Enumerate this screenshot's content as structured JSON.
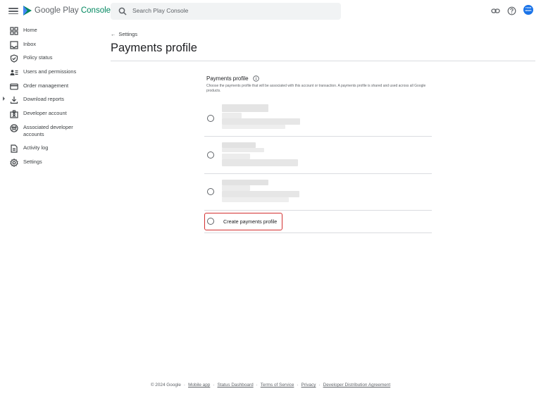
{
  "header": {
    "brand_text": "Google Play",
    "brand_accent": "Console",
    "search_placeholder": "Search Play Console",
    "avatar_text": "YOUR NEWS",
    "accent_color": "#01875f",
    "avatar_color": "#1a73e8"
  },
  "sidebar": {
    "items": [
      {
        "label": "Home",
        "icon": "grid-icon"
      },
      {
        "label": "Inbox",
        "icon": "inbox-icon"
      },
      {
        "label": "Policy status",
        "icon": "shield-icon"
      },
      {
        "label": "Users and permissions",
        "icon": "users-icon"
      },
      {
        "label": "Order management",
        "icon": "credit-card-icon"
      },
      {
        "label": "Download reports",
        "icon": "download-icon",
        "expandable": true
      },
      {
        "label": "Developer account",
        "icon": "badge-icon"
      },
      {
        "label": "Associated developer accounts",
        "icon": "linked-accounts-icon"
      },
      {
        "label": "Activity log",
        "icon": "document-icon"
      },
      {
        "label": "Settings",
        "icon": "gear-icon"
      }
    ]
  },
  "main": {
    "back_label": "Settings",
    "page_title": "Payments profile",
    "section_title": "Payments profile",
    "section_description": "Choose the payments profile that will be associated with this account or transaction. A payments profile is shared and used across all Google products.",
    "options_note": "Three existing payments profiles are shown with redacted (blurred) details.",
    "create_option_label": "Create payments profile",
    "highlight_color": "#d32f2f"
  },
  "footer": {
    "copyright": "© 2024 Google",
    "links": [
      "Mobile app",
      "Status Dashboard",
      "Terms of Service",
      "Privacy",
      "Developer Distribution Agreement"
    ]
  }
}
